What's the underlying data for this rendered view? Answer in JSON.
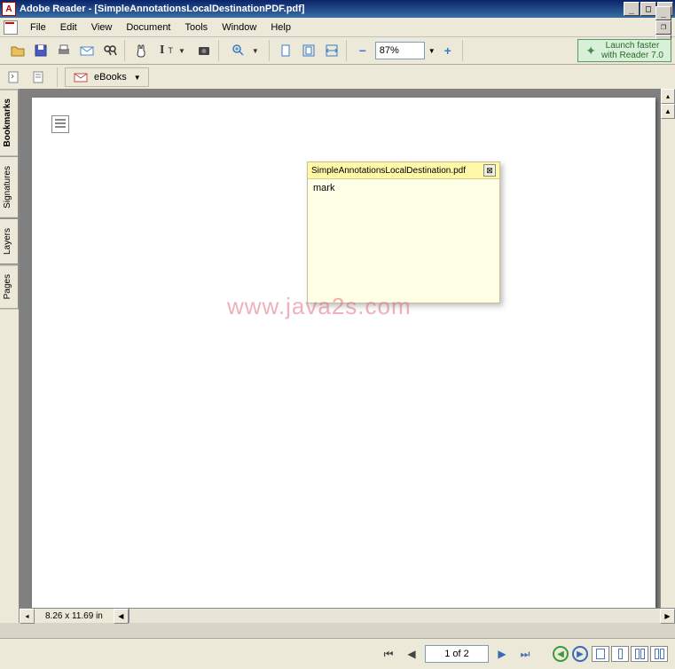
{
  "title": "Adobe Reader - [SimpleAnnotationsLocalDestinationPDF.pdf]",
  "menu": {
    "file": "File",
    "edit": "Edit",
    "view": "View",
    "document": "Document",
    "tools": "Tools",
    "window": "Window",
    "help": "Help"
  },
  "toolbar": {
    "zoom_value": "87%",
    "ebooks_label": "eBooks"
  },
  "promo": {
    "line1": "Launch faster",
    "line2": "with Reader 7.0"
  },
  "sidetabs": {
    "bookmarks": "Bookmarks",
    "signatures": "Signatures",
    "layers": "Layers",
    "pages": "Pages"
  },
  "annotation": {
    "title": "SimpleAnnotationsLocalDestination.pdf",
    "body": "mark"
  },
  "watermark": "www.java2s.com",
  "status": {
    "dimensions": "8.26 x 11.69 in"
  },
  "nav": {
    "page_display": "1 of 2"
  }
}
